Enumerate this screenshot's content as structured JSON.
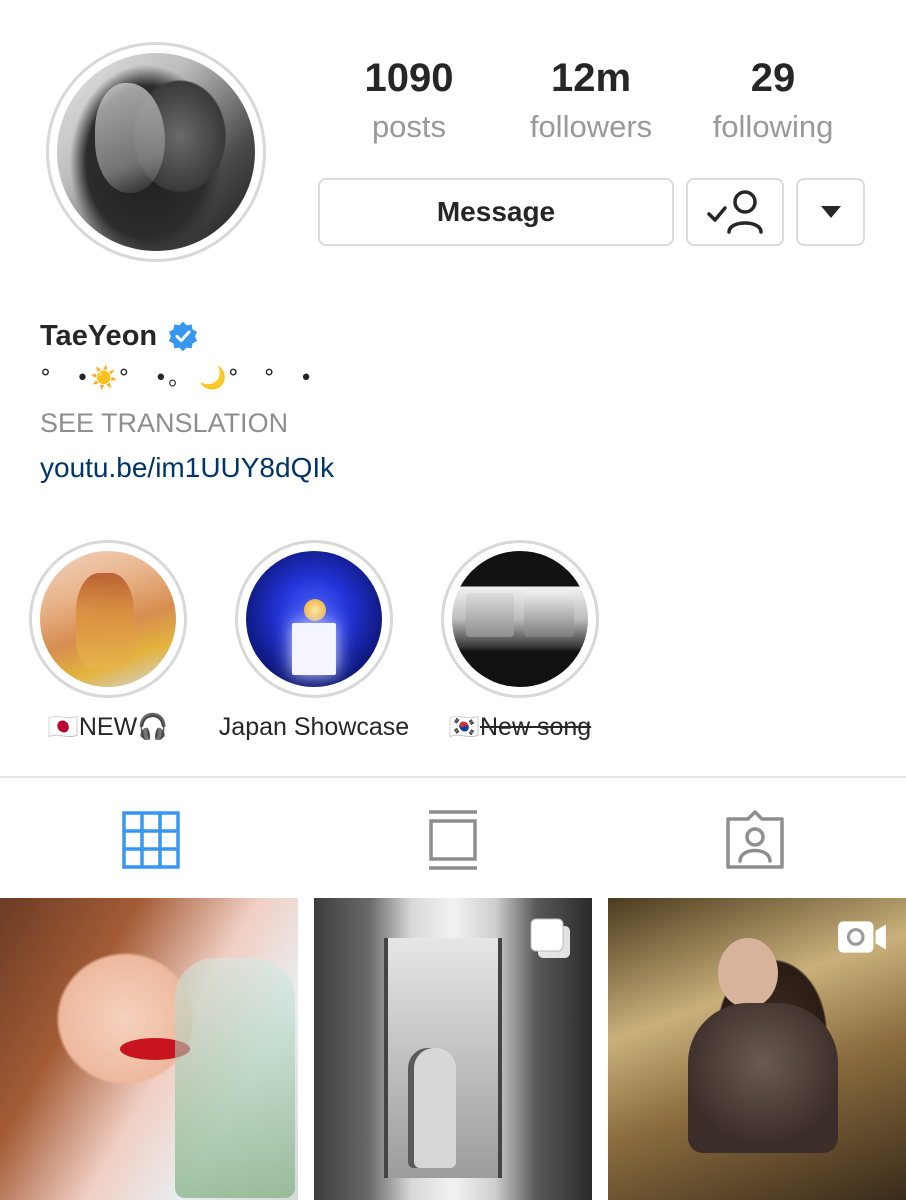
{
  "profile": {
    "username": "TaeYeon",
    "verified": true,
    "bio_line": "°   •☀️°   •。 🌙°   °   •",
    "see_translation": "SEE TRANSLATION",
    "link": "youtu.be/im1UUY8dQIk"
  },
  "stats": [
    {
      "value": "1090",
      "label": "posts"
    },
    {
      "value": "12m",
      "label": "followers"
    },
    {
      "value": "29",
      "label": "following"
    }
  ],
  "actions": {
    "message_label": "Message",
    "following_icon": "person-check-icon",
    "dropdown_icon": "caret-down-icon"
  },
  "highlights": [
    {
      "label_prefix": "🇯🇵",
      "label": "NEW🎧"
    },
    {
      "label_prefix": "",
      "label": "Japan Showcase"
    },
    {
      "label_prefix": "🇰🇷",
      "label": "New song"
    }
  ],
  "tabs": [
    {
      "icon": "grid-icon",
      "active": true
    },
    {
      "icon": "feed-icon",
      "active": false
    },
    {
      "icon": "tagged-icon",
      "active": false
    }
  ],
  "posts": [
    {
      "badge": ""
    },
    {
      "badge": "carousel-icon"
    },
    {
      "badge": "video-icon"
    }
  ],
  "colors": {
    "verified_blue": "#3897f0",
    "active_tab_blue": "#3897f0",
    "link_blue": "#003569",
    "muted_gray": "#8e8e8e"
  }
}
